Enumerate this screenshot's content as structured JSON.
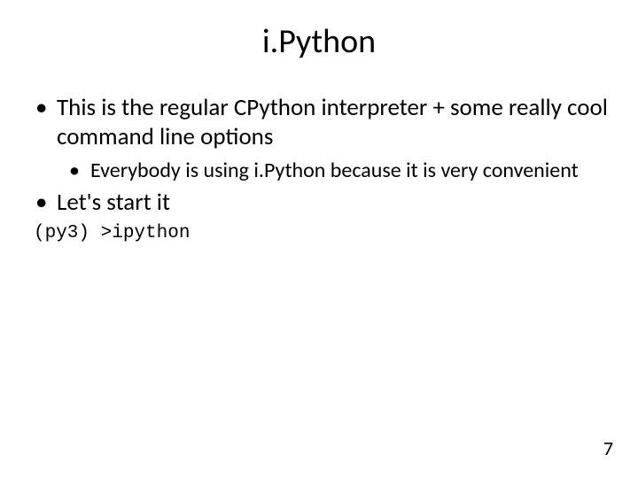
{
  "title": "i.Python",
  "bullets": {
    "b1": "This is the regular CPython interpreter + some really cool command line options",
    "b1_sub": "Everybody is using i.Python because it is very convenient",
    "b2": "Let's start it"
  },
  "code_line": "(py3) >ipython",
  "page_number": "7"
}
